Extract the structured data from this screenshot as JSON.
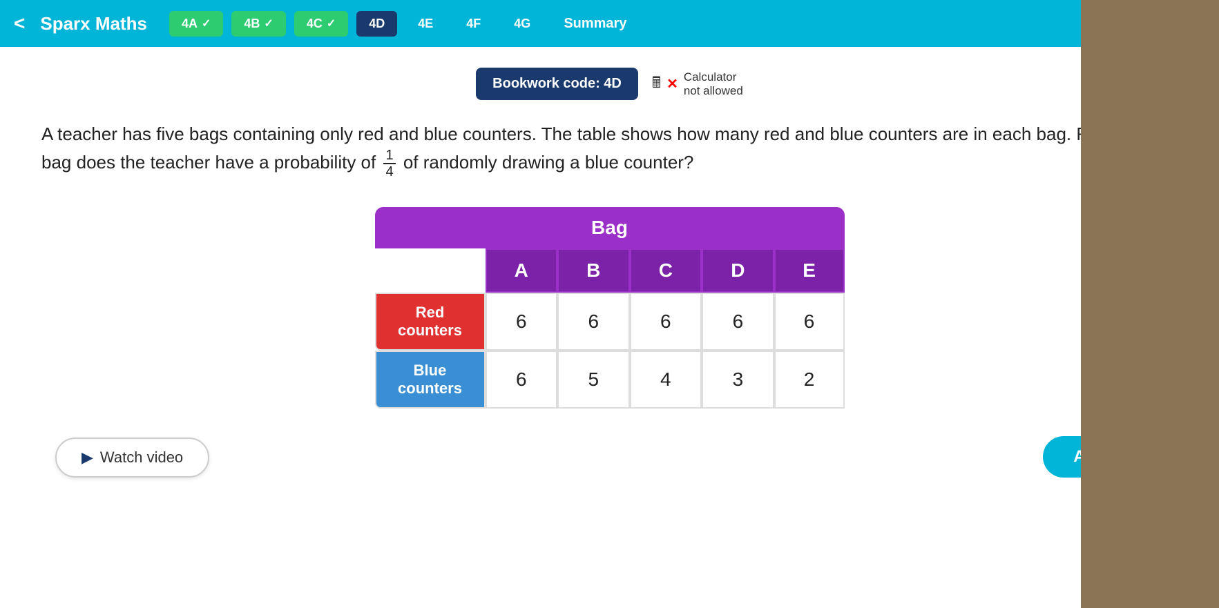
{
  "topbar": {
    "brand": "Sparx Maths",
    "back_label": "<",
    "tabs": [
      {
        "id": "4A",
        "label": "4A",
        "state": "completed",
        "check": "✓"
      },
      {
        "id": "4B",
        "label": "4B",
        "state": "completed",
        "check": "✓"
      },
      {
        "id": "4C",
        "label": "4C",
        "state": "completed",
        "check": "✓"
      },
      {
        "id": "4D",
        "label": "4D",
        "state": "active"
      },
      {
        "id": "4E",
        "label": "4E",
        "state": "inactive"
      },
      {
        "id": "4F",
        "label": "4F",
        "state": "inactive"
      },
      {
        "id": "4G",
        "label": "4G",
        "state": "inactive"
      },
      {
        "id": "Summary",
        "label": "Summary",
        "state": "summary"
      }
    ]
  },
  "bookwork": {
    "label": "Bookwork code: 4D",
    "calculator_text": "Calculator",
    "not_allowed_text": "not allowed"
  },
  "question": {
    "text_part1": "A teacher has five bags containing only red and blue counters. The table shows how many red and blue counters are in each bag. From which bag does the teacher have a probability of ",
    "fraction_num": "1",
    "fraction_den": "4",
    "text_part2": " of randomly drawing a blue counter?"
  },
  "table": {
    "header": "Bag",
    "columns": [
      "A",
      "B",
      "C",
      "D",
      "E"
    ],
    "rows": [
      {
        "label": "Red counters",
        "type": "red",
        "values": [
          "6",
          "6",
          "6",
          "6",
          "6"
        ]
      },
      {
        "label": "Blue counters",
        "type": "blue",
        "values": [
          "6",
          "5",
          "4",
          "3",
          "2"
        ]
      }
    ]
  },
  "buttons": {
    "watch_video": "Watch video",
    "answer": "Answer"
  }
}
